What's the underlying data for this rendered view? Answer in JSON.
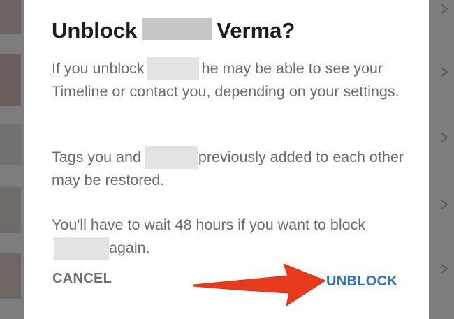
{
  "dialog": {
    "title_prefix": "Unblock",
    "title_suffix": "Verma?",
    "paragraphs": {
      "p1_before": "If you unblock",
      "p1_after": "he may be able to see your Timeline or contact you, depending on your settings.",
      "p2_before": "Tags you and",
      "p2_after": "previously added to each other may be restored.",
      "p3_before": "You'll have to wait 48 hours if you want to block",
      "p3_after": "again."
    },
    "buttons": {
      "cancel": "CANCEL",
      "unblock": "UNBLOCK"
    }
  },
  "colors": {
    "unblock_accent": "#2f6fbf",
    "arrow": "#e83a1f",
    "backdrop": "#7d7d7d"
  },
  "icons": {
    "annotation": "red-arrow-icon",
    "list_chevron": "chevron-right-icon"
  }
}
